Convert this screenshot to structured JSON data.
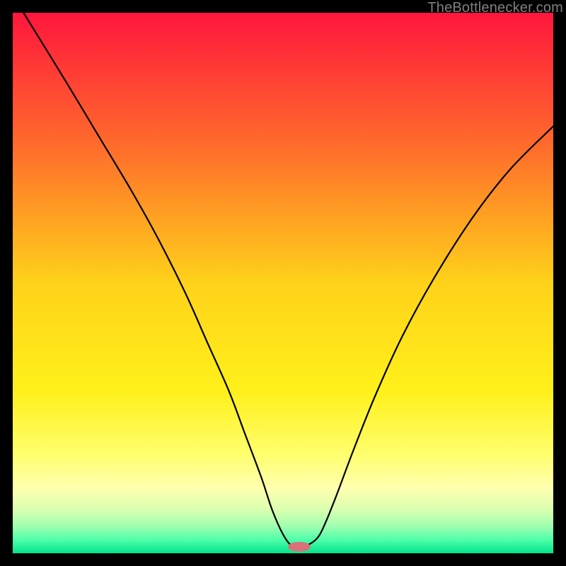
{
  "attribution": "TheBottlenecker.com",
  "chart_data": {
    "type": "line",
    "title": "",
    "xlabel": "",
    "ylabel": "",
    "xlim": [
      0,
      100
    ],
    "ylim": [
      0,
      100
    ],
    "series": [
      {
        "name": "bottleneck-curve",
        "x": [
          2,
          10,
          16,
          22,
          27,
          32,
          36,
          40,
          43,
          46,
          48,
          50,
          51.5,
          53,
          54.5,
          56.5,
          58,
          60,
          63,
          67,
          72,
          78,
          85,
          92,
          100
        ],
        "y": [
          100,
          87,
          77,
          67,
          58,
          48,
          39,
          30,
          22,
          14,
          8,
          3.5,
          1.5,
          1.5,
          1.5,
          3,
          6,
          11,
          19,
          29,
          40,
          51,
          62,
          71,
          79
        ]
      }
    ],
    "marker": {
      "name": "optimal-zone",
      "x": 53,
      "y": 1.2,
      "rx": 2.1,
      "ry": 0.9,
      "color": "#d9707a"
    },
    "gradient": {
      "stops": [
        {
          "offset": 0.0,
          "color": "#ff163d"
        },
        {
          "offset": 0.25,
          "color": "#ff6d2b"
        },
        {
          "offset": 0.5,
          "color": "#ffd21a"
        },
        {
          "offset": 0.7,
          "color": "#fff01a"
        },
        {
          "offset": 0.82,
          "color": "#ffff70"
        },
        {
          "offset": 0.88,
          "color": "#ffffb0"
        },
        {
          "offset": 0.92,
          "color": "#d9ffb0"
        },
        {
          "offset": 0.95,
          "color": "#9fffb0"
        },
        {
          "offset": 0.975,
          "color": "#4fffaa"
        },
        {
          "offset": 1.0,
          "color": "#00e48a"
        }
      ]
    }
  }
}
